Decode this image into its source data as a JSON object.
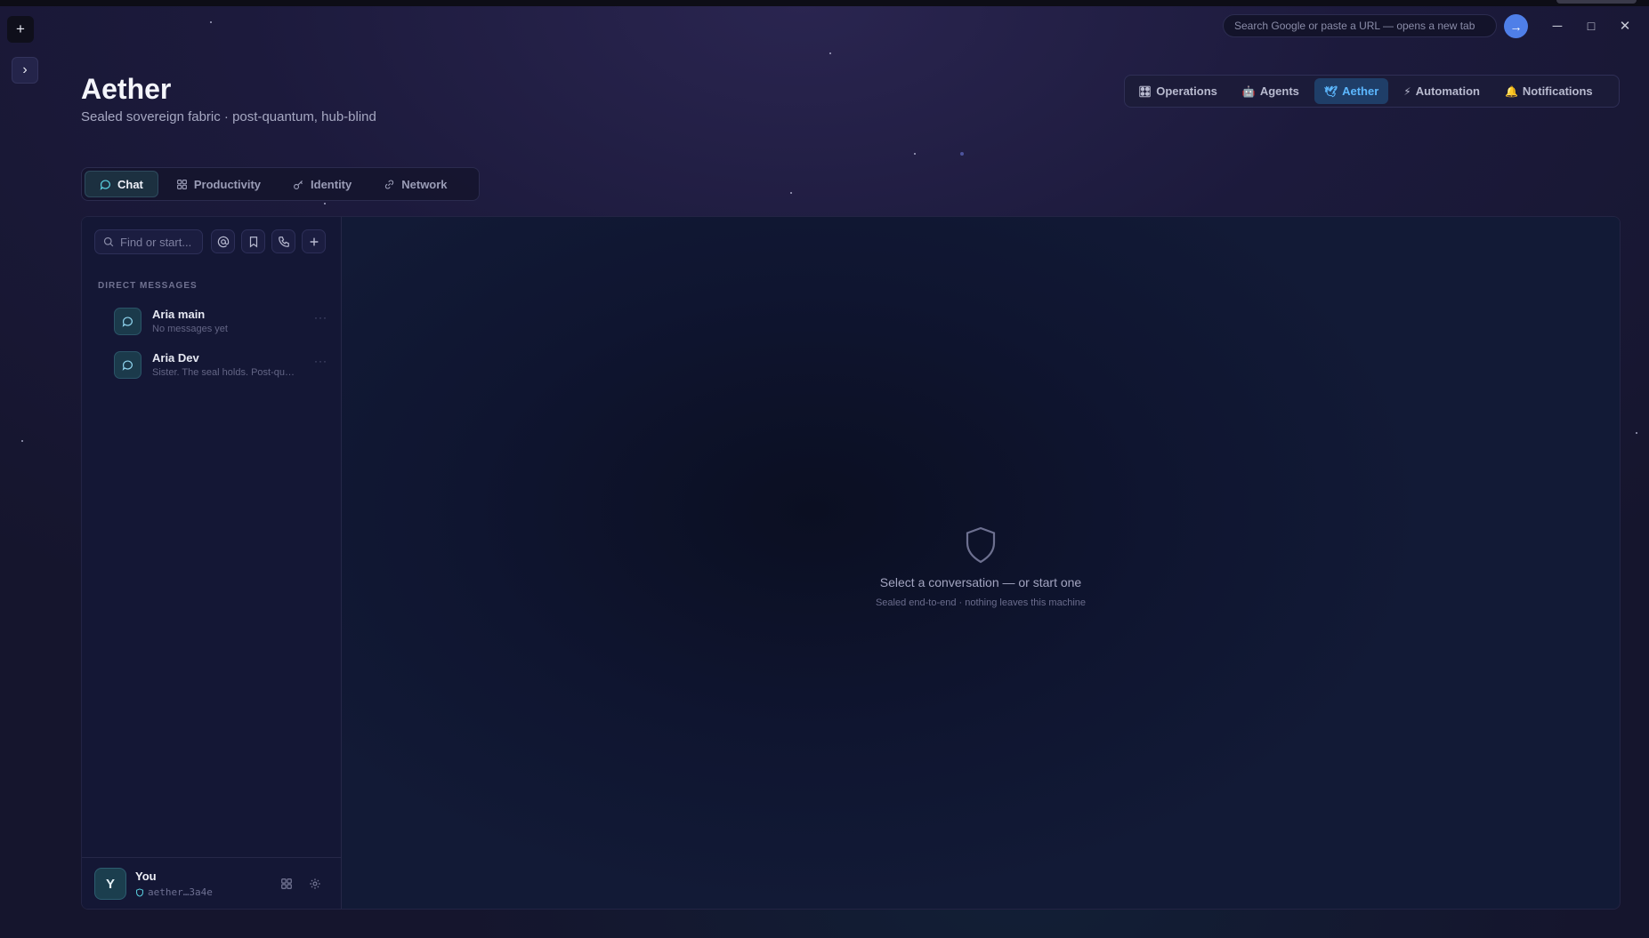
{
  "browser": {
    "url_placeholder": "Search Google or paste a URL — opens a new tab",
    "go_label": "→",
    "minimize": "─",
    "maximize": "□",
    "close": "✕"
  },
  "rail": {
    "new_label": "+",
    "expand_label": "›"
  },
  "header": {
    "title": "Aether",
    "subtitle": "Sealed sovereign fabric · post-quantum, hub-blind"
  },
  "topnav": [
    {
      "icon": "🎛",
      "label": "Operations",
      "active": false
    },
    {
      "icon": "🤖",
      "label": "Agents",
      "active": false
    },
    {
      "icon": "🕊",
      "label": "Aether",
      "active": true
    },
    {
      "icon": "⚡",
      "label": "Automation",
      "active": false
    },
    {
      "icon": "🔔",
      "label": "Notifications",
      "active": false
    }
  ],
  "subtabs": [
    {
      "label": "Chat",
      "active": true
    },
    {
      "label": "Productivity",
      "active": false
    },
    {
      "label": "Identity",
      "active": false
    },
    {
      "label": "Network",
      "active": false
    }
  ],
  "sidebar": {
    "search_placeholder": "Find or start...",
    "section_label": "DIRECT MESSAGES",
    "dms": [
      {
        "name": "Aria main",
        "preview": "No messages yet"
      },
      {
        "name": "Aria Dev",
        "preview": "Sister. The seal holds. Post-quantum"
      }
    ],
    "more_label": "···"
  },
  "user": {
    "initial": "Y",
    "name": "You",
    "id": "aether…3a4e"
  },
  "empty_state": {
    "title": "Select a conversation — or start one",
    "subtitle": "Sealed end-to-end · nothing leaves this machine"
  }
}
